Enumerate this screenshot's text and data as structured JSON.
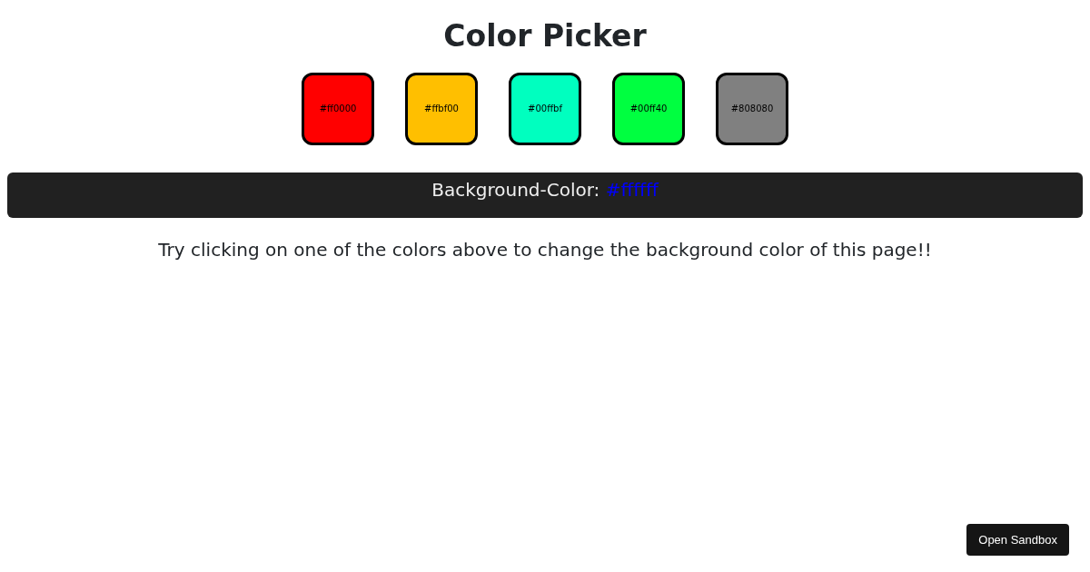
{
  "title": "Color Picker",
  "swatches": [
    {
      "label": "#ff0000",
      "color": "#ff0000"
    },
    {
      "label": "#ffbf00",
      "color": "#ffbf00"
    },
    {
      "label": "#00ffbf",
      "color": "#00ffbf"
    },
    {
      "label": "#00ff40",
      "color": "#00ff40"
    },
    {
      "label": "#808080",
      "color": "#808080"
    }
  ],
  "background_bar": {
    "label": "Background-Color:",
    "value": "#ffffff"
  },
  "instruction": "Try clicking on one of the colors above to change the background color of this page!!",
  "sandbox_button": "Open Sandbox"
}
